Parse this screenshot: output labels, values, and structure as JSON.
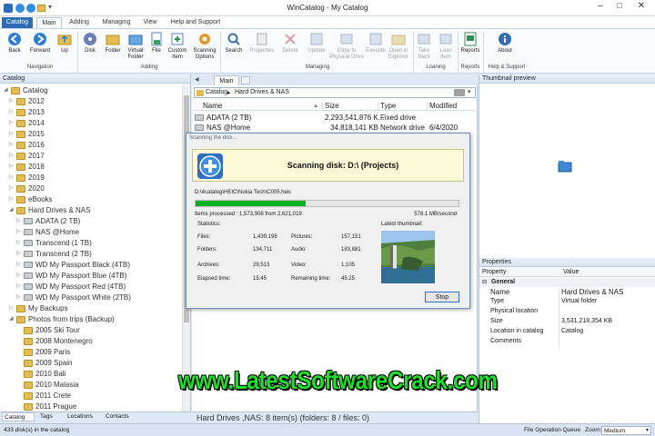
{
  "window": {
    "title": "WinCatalog - My Catalog",
    "qat_arrow": "▾"
  },
  "menu_tabs": [
    "Catalog",
    "Main",
    "Adding",
    "Managing",
    "View",
    "Help and Support"
  ],
  "ribbon": {
    "buttons": [
      "Back",
      "Forward",
      "Up",
      "Disk",
      "Folder",
      "Virtual Folder",
      "File",
      "Custom Item",
      "Scanning Options",
      "Search",
      "Properties",
      "Delete",
      "Update",
      "Copy to Physical Drive",
      "Execute",
      "Open in Explorer",
      "Take Back",
      "Loan Item",
      "Reports",
      "About"
    ],
    "groups": [
      "Navigation",
      "Adding",
      "Managing",
      "Loaning",
      "Reports",
      "Help & Support"
    ]
  },
  "catalog_panel": {
    "title": "Catalog",
    "items": [
      {
        "label": "Catalog",
        "kind": "folder",
        "open": true
      },
      {
        "label": "2012",
        "kind": "folder"
      },
      {
        "label": "2013",
        "kind": "folder"
      },
      {
        "label": "2014",
        "kind": "folder"
      },
      {
        "label": "2015",
        "kind": "folder"
      },
      {
        "label": "2016",
        "kind": "folder"
      },
      {
        "label": "2017",
        "kind": "folder"
      },
      {
        "label": "2018",
        "kind": "folder"
      },
      {
        "label": "2019",
        "kind": "folder"
      },
      {
        "label": "2020",
        "kind": "folder"
      },
      {
        "label": "eBooks",
        "kind": "folder"
      },
      {
        "label": "Hard Drives & NAS",
        "kind": "folder",
        "open": true
      },
      {
        "label": "ADATA (2 TB)",
        "kind": "drive"
      },
      {
        "label": "NAS @Home",
        "kind": "drive"
      },
      {
        "label": "Transcend (1 TB)",
        "kind": "drive"
      },
      {
        "label": "Transcend (2 TB)",
        "kind": "drive"
      },
      {
        "label": "WD My Passport Black (4TB)",
        "kind": "drive"
      },
      {
        "label": "WD My Passport Blue (4TB)",
        "kind": "drive"
      },
      {
        "label": "WD My Passport Red (4TB)",
        "kind": "drive"
      },
      {
        "label": "WD My Passport White (2TB)",
        "kind": "drive"
      },
      {
        "label": "My Backups",
        "kind": "folder"
      },
      {
        "label": "Photos from trips (Backup)",
        "kind": "folder",
        "open": true
      },
      {
        "label": "2005 Ski Tour",
        "kind": "folder"
      },
      {
        "label": "2008 Montenegro",
        "kind": "folder"
      },
      {
        "label": "2009 Paris",
        "kind": "folder"
      },
      {
        "label": "2009 Spain",
        "kind": "folder"
      },
      {
        "label": "2010 Bali",
        "kind": "folder"
      },
      {
        "label": "2010 Malasia",
        "kind": "folder"
      },
      {
        "label": "2011 Crete",
        "kind": "folder"
      },
      {
        "label": "2011 Prague",
        "kind": "folder"
      }
    ],
    "bottom_tabs": [
      "Catalog",
      "Tags",
      "Locations",
      "Contacts"
    ]
  },
  "main_panel": {
    "tab": "Main",
    "breadcrumb": [
      "Catalog",
      "Hard Drives & NAS"
    ],
    "columns": [
      "Name",
      "Size",
      "Type",
      "Modified"
    ],
    "rows": [
      {
        "name": "ADATA (2 TB)",
        "size": "2,293,541,876 K...",
        "type": "Fixed drive",
        "modified": ""
      },
      {
        "name": "NAS @Home",
        "size": "34,818,141 KB",
        "type": "Network drive",
        "modified": "6/4/2020"
      }
    ],
    "footer": "Hard Drives ,NAS: 8 item(s) (folders: 8 / files: 0)"
  },
  "scan_dialog": {
    "title": "Scanning the disk...",
    "heading": "Scanning disk: D:\\ (Projects)",
    "current_path": "D:\\4catalog\\HEIC\\Nokia Tech\\C005.heic",
    "progress": 0.42,
    "items_processed": "Items processed : 1,573,908 from 2,621,019",
    "speed": "578.1 MB/second",
    "stats_title": "Statistics:",
    "latest_thumb_label": "Latest thumbnail:",
    "stats": [
      {
        "label": "Files:",
        "value": "1,439,198",
        "label2": "Pictures:",
        "value2": "157,151"
      },
      {
        "label": "Folders:",
        "value": "134,711",
        "label2": "Audio:",
        "value2": "183,881"
      },
      {
        "label": "Archives:",
        "value": "29,513",
        "label2": "Video:",
        "value2": "1,105"
      },
      {
        "label": "Elapsed time:",
        "value": "15:45",
        "label2": "Remaining time:",
        "value2": "45:25"
      }
    ],
    "stop_label": "Stop"
  },
  "thumb_panel": {
    "title": "Thumbnail preview"
  },
  "properties": {
    "title": "Properties",
    "col_property": "Property",
    "col_value": "Value",
    "group": "General",
    "rows": [
      {
        "k": "Name",
        "v": "Hard Drives & NAS"
      },
      {
        "k": "Type",
        "v": "Virtual folder"
      },
      {
        "k": "Physical location",
        "v": ""
      },
      {
        "k": "Size",
        "v": "3,531,218,354 KB"
      },
      {
        "k": "Location in catalog",
        "v": "Catalog"
      },
      {
        "k": "Comments",
        "v": ""
      }
    ]
  },
  "status_bar": {
    "left": "433 disk(s) in the catalog",
    "queue": "File Operation Queue",
    "zoom_label": "Zoom:",
    "zoom_value": "Medium"
  },
  "watermark": "www.LatestSoftwareCrack.com"
}
